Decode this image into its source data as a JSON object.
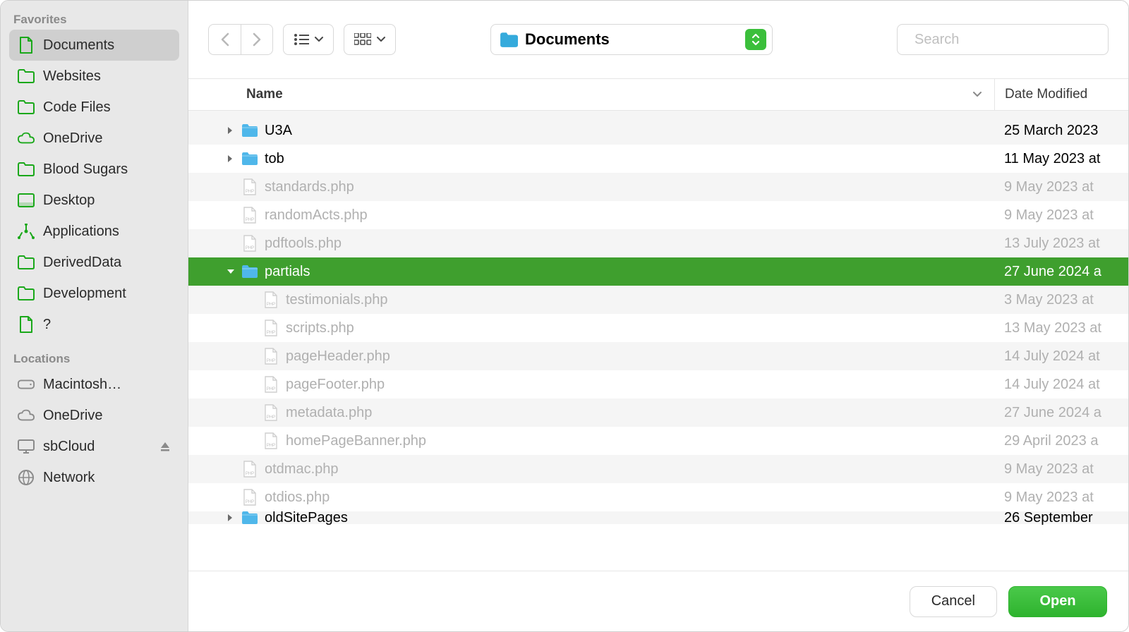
{
  "sidebar": {
    "favorites_label": "Favorites",
    "locations_label": "Locations",
    "favorites": [
      {
        "label": "Documents",
        "icon": "doc",
        "selected": true
      },
      {
        "label": "Websites",
        "icon": "folder"
      },
      {
        "label": "Code Files",
        "icon": "folder"
      },
      {
        "label": "OneDrive",
        "icon": "cloud"
      },
      {
        "label": "Blood Sugars",
        "icon": "folder"
      },
      {
        "label": "Desktop",
        "icon": "desktop"
      },
      {
        "label": "Applications",
        "icon": "apps"
      },
      {
        "label": "DerivedData",
        "icon": "folder"
      },
      {
        "label": "Development",
        "icon": "folder"
      },
      {
        "label": "?",
        "icon": "doc"
      }
    ],
    "locations": [
      {
        "label": "Macintosh…",
        "icon": "hdd"
      },
      {
        "label": "OneDrive",
        "icon": "cloud-gray"
      },
      {
        "label": "sbCloud",
        "icon": "monitor",
        "eject": true
      },
      {
        "label": "Network",
        "icon": "globe"
      }
    ]
  },
  "toolbar": {
    "path_label": "Documents",
    "search_placeholder": "Search"
  },
  "columns": {
    "name_label": "Name",
    "date_label": "Date Modified"
  },
  "rows": [
    {
      "indent": 1,
      "type": "folder",
      "disclosure": "right",
      "name": "U3A",
      "date": "25 March 2023",
      "dimmed": false
    },
    {
      "indent": 1,
      "type": "folder",
      "disclosure": "right",
      "name": "tob",
      "date": "11 May 2023 at",
      "dimmed": false
    },
    {
      "indent": 1,
      "type": "php",
      "disclosure": "",
      "name": "standards.php",
      "date": "9 May 2023 at",
      "dimmed": true
    },
    {
      "indent": 1,
      "type": "php",
      "disclosure": "",
      "name": "randomActs.php",
      "date": "9 May 2023 at",
      "dimmed": true
    },
    {
      "indent": 1,
      "type": "php",
      "disclosure": "",
      "name": "pdftools.php",
      "date": "13 July 2023 at",
      "dimmed": true
    },
    {
      "indent": 1,
      "type": "folder",
      "disclosure": "down",
      "name": "partials",
      "date": "27 June 2024 a",
      "selected": true
    },
    {
      "indent": 2,
      "type": "php",
      "disclosure": "",
      "name": "testimonials.php",
      "date": "3 May 2023 at",
      "dimmed": true
    },
    {
      "indent": 2,
      "type": "php",
      "disclosure": "",
      "name": "scripts.php",
      "date": "13 May 2023 at",
      "dimmed": true
    },
    {
      "indent": 2,
      "type": "php",
      "disclosure": "",
      "name": "pageHeader.php",
      "date": "14 July 2024 at",
      "dimmed": true
    },
    {
      "indent": 2,
      "type": "php",
      "disclosure": "",
      "name": "pageFooter.php",
      "date": "14 July 2024 at",
      "dimmed": true
    },
    {
      "indent": 2,
      "type": "php",
      "disclosure": "",
      "name": "metadata.php",
      "date": "27 June 2024 a",
      "dimmed": true
    },
    {
      "indent": 2,
      "type": "php",
      "disclosure": "",
      "name": "homePageBanner.php",
      "date": "29 April 2023 a",
      "dimmed": true
    },
    {
      "indent": 1,
      "type": "php",
      "disclosure": "",
      "name": "otdmac.php",
      "date": "9 May 2023 at",
      "dimmed": true
    },
    {
      "indent": 1,
      "type": "php",
      "disclosure": "",
      "name": "otdios.php",
      "date": "9 May 2023 at",
      "dimmed": true
    },
    {
      "indent": 1,
      "type": "folder",
      "disclosure": "right",
      "name": "oldSitePages",
      "date": "26 September",
      "dimmed": false,
      "cut": true
    }
  ],
  "footer": {
    "cancel_label": "Cancel",
    "open_label": "Open"
  }
}
